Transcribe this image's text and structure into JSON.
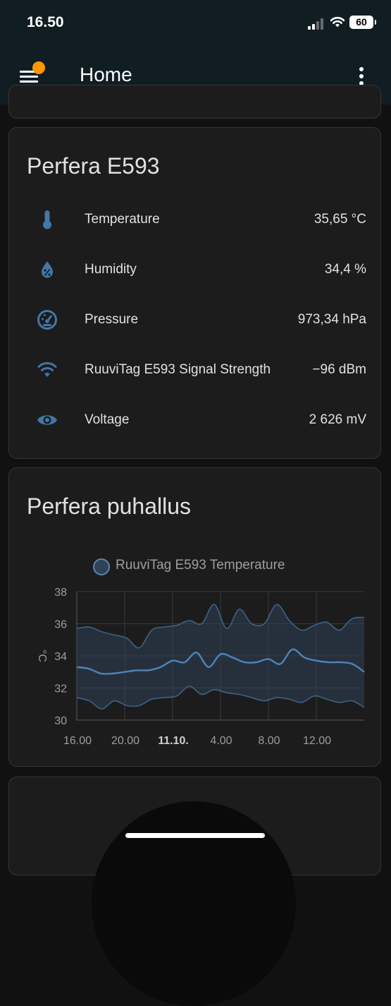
{
  "status_bar": {
    "time": "16.50",
    "battery": "60"
  },
  "app_bar": {
    "title": "Home"
  },
  "sensor_card": {
    "title": "Perfera E593",
    "rows": [
      {
        "icon": "thermometer-icon",
        "label": "Temperature",
        "value": "35,65 °C"
      },
      {
        "icon": "water-percent-icon",
        "label": "Humidity",
        "value": "34,4 %"
      },
      {
        "icon": "gauge-icon",
        "label": "Pressure",
        "value": "973,34 hPa"
      },
      {
        "icon": "wifi-icon",
        "label": "RuuviTag E593 Signal Strength",
        "value": "−96 dBm"
      },
      {
        "icon": "eye-icon",
        "label": "Voltage",
        "value": "2 626 mV"
      }
    ]
  },
  "chart_card": {
    "title": "Perfera puhallus"
  },
  "colors": {
    "accent": "#4f84b8",
    "band": "#2e4258",
    "icon": "#4476a8",
    "notification": "#ff9800",
    "app_bar": "#101e24"
  },
  "chart_data": {
    "type": "line",
    "legend": [
      "RuuviTag E593 Temperature"
    ],
    "ylabel": "°C",
    "ylim": [
      30,
      38
    ],
    "y_ticks": [
      "30",
      "32",
      "34",
      "36",
      "38"
    ],
    "x_ticks": [
      {
        "label": "16.00",
        "bold": false
      },
      {
        "label": "20.00",
        "bold": false
      },
      {
        "label": "11.10.",
        "bold": true
      },
      {
        "label": "4.00",
        "bold": false
      },
      {
        "label": "8.00",
        "bold": false
      },
      {
        "label": "12.00",
        "bold": false
      }
    ],
    "x_hours": [
      0,
      1,
      2,
      3,
      4,
      5,
      6,
      7,
      8,
      9,
      10,
      11,
      12,
      13,
      14,
      15,
      16,
      17,
      18,
      19,
      20,
      21,
      22,
      23
    ],
    "x_hours_note_removed": true,
    "series": [
      {
        "values": [
          33.3,
          33.2,
          32.9,
          32.9,
          33.0,
          33.1,
          33.1,
          33.3,
          33.7,
          33.6,
          34.2,
          33.3,
          34.1,
          33.9,
          33.6,
          33.6,
          33.8,
          33.5,
          34.4,
          33.9,
          33.7,
          33.6,
          33.6,
          33.5,
          33.0
        ]
      }
    ],
    "max": [
      35.7,
      35.8,
      35.5,
      35.3,
      35.1,
      34.5,
      35.6,
      35.8,
      35.9,
      36.2,
      36.0,
      37.2,
      35.7,
      36.9,
      36.0,
      36.0,
      37.2,
      36.2,
      35.6,
      35.9,
      36.1,
      35.6,
      36.3,
      36.4
    ],
    "min": [
      31.4,
      31.2,
      30.7,
      31.2,
      30.9,
      30.9,
      31.3,
      31.4,
      31.5,
      32.1,
      31.6,
      31.9,
      31.7,
      31.6,
      31.4,
      31.2,
      31.4,
      31.3,
      31.1,
      31.5,
      31.3,
      31.1,
      31.2,
      30.8
    ]
  }
}
